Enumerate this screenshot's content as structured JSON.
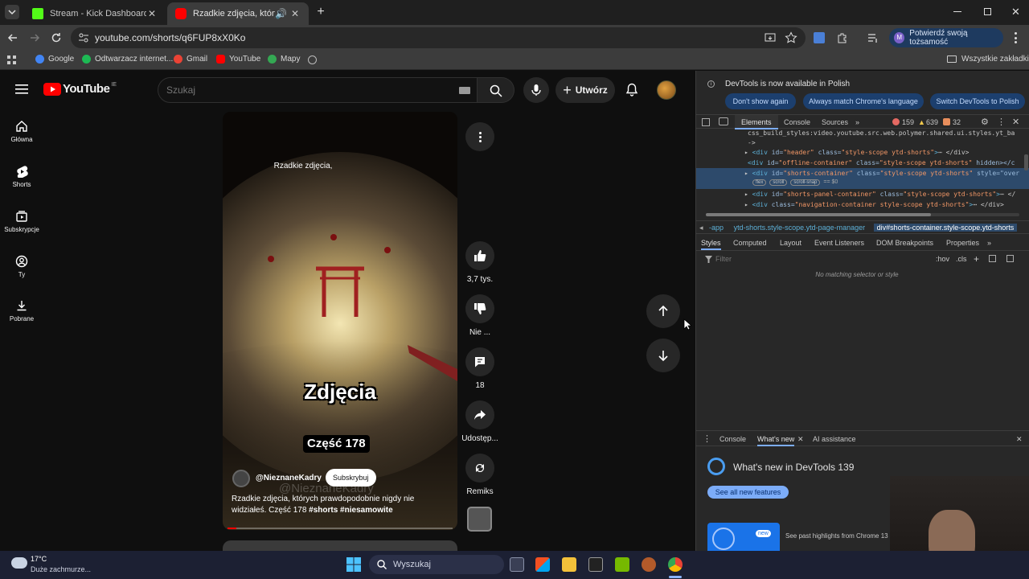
{
  "browser": {
    "tabs": [
      {
        "title": "Stream - Kick Dashboard",
        "color": "#53fc18"
      },
      {
        "title": "Rzadkie zdjęcia, których pra",
        "color": "#ff0000"
      }
    ],
    "url": "youtube.com/shorts/q6FUP8xX0Ko",
    "verify_label": "Potwierdź swoją tożsamość",
    "avatar_letter": "M",
    "bookmarks": [
      {
        "label": "Google",
        "color": "#4285f4"
      },
      {
        "label": "Odtwarzacz internet...",
        "color": "#1db954"
      },
      {
        "label": "Gmail",
        "color": "#ea4335"
      },
      {
        "label": "YouTube",
        "color": "#ff0000"
      },
      {
        "label": "Mapy",
        "color": "#34a853"
      }
    ],
    "all_bookmarks": "Wszystkie zakładki"
  },
  "youtube": {
    "logo_text": "YouTube",
    "region": "IE",
    "search_placeholder": "Szukaj",
    "create_label": "Utwórz",
    "nav": [
      {
        "label": "Główna",
        "icon": "home-icon"
      },
      {
        "label": "Shorts",
        "icon": "shorts-icon"
      },
      {
        "label": "Subskrypcje",
        "icon": "subscriptions-icon"
      },
      {
        "label": "Ty",
        "icon": "you-icon"
      },
      {
        "label": "Pobrane",
        "icon": "download-icon"
      }
    ],
    "short": {
      "top_caption": "Rzadkie zdjęcia,",
      "big_caption": "Zdjęcia",
      "part_caption": "Część 178",
      "watermark": "@NieznaneKadry",
      "channel": "@NieznaneKadry",
      "subscribe": "Subskrybuj",
      "description": "Rzadkie zdjęcia, których prawdopodobnie nigdy nie widziałeś. Część 178",
      "hashtags": "#shorts #niesamowite"
    },
    "actions": {
      "likes": "3,7 tys.",
      "dislike": "Nie ...",
      "comments": "18",
      "share": "Udostęp...",
      "remix": "Remiks"
    }
  },
  "devtools": {
    "banner": "DevTools is now available in Polish",
    "btn_dont_show": "Don't show again",
    "btn_match": "Always match Chrome's language",
    "btn_switch": "Switch DevTools to Polish",
    "tabs": [
      "Elements",
      "Console",
      "Sources"
    ],
    "errors": "159",
    "warnings": "639",
    "infos": "32",
    "code_lines": [
      {
        "indent": 64,
        "text": "css_build_styles:video.youtube.src.web.polymer.shared.ui.styles.yt_ba"
      },
      {
        "indent": 64,
        "text": "->"
      },
      {
        "indent": 64,
        "tag": "div",
        "id": "header",
        "cls": "style-scope ytd-shorts",
        "tail": "⋯ </div>"
      },
      {
        "indent": 64,
        "tag": "div",
        "id": "offline-container",
        "cls": "style-scope ytd-shorts",
        "tail": "hidden></c"
      },
      {
        "indent": 64,
        "tag": "div",
        "id": "shorts-container",
        "cls": "style-scope ytd-shorts",
        "tail": "style=\"over"
      },
      {
        "indent": 64,
        "tag": "div",
        "id": "shorts-panel-container",
        "cls": "style-scope ytd-shorts",
        "tail": "⋯ </"
      },
      {
        "indent": 64,
        "tag": "div",
        "cls": "navigation-container style-scope ytd-shorts",
        "tail": "⋯ </div>"
      }
    ],
    "badges": [
      "flex",
      "scroll",
      "scroll-snap"
    ],
    "eq0": "== $0",
    "breadcrumb_1": "-app",
    "breadcrumb_2": "ytd-shorts.style-scope.ytd-page-manager",
    "breadcrumb_3": "div#shorts-container.style-scope.ytd-shorts",
    "style_tabs": [
      "Styles",
      "Computed",
      "Layout",
      "Event Listeners",
      "DOM Breakpoints",
      "Properties"
    ],
    "filter_placeholder": "Filter",
    "hov": ":hov",
    "cls": ".cls",
    "no_match": "No matching selector or style",
    "drawer_tabs": [
      "Console",
      "What's new",
      "AI assistance"
    ],
    "whats_new_title": "What's new in DevTools 139",
    "see_all": "See all new features",
    "new_badge": "new",
    "highlights": "See past highlights from Chrome 13"
  },
  "taskbar": {
    "temp": "17°C",
    "weather": "Duże zachmurze...",
    "search": "Wyszukaj"
  }
}
